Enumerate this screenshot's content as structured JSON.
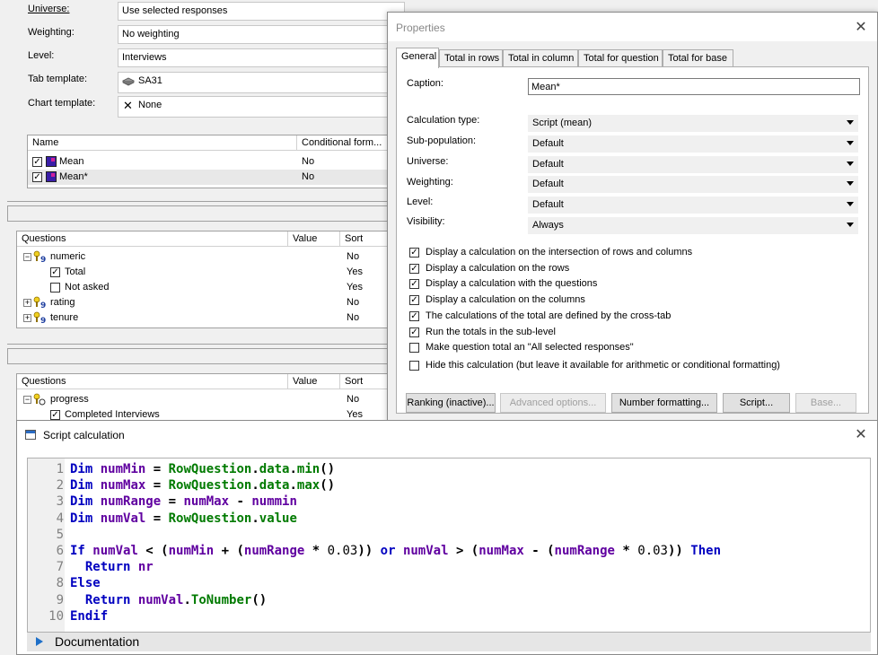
{
  "settings": {
    "universe_label": "Universe:",
    "universe_value": "Use selected responses",
    "weighting_label": "Weighting:",
    "weighting_value": "No weighting",
    "level_label": "Level:",
    "level_value": "Interviews",
    "tab_template_label": "Tab template:",
    "tab_template_value": "SA31",
    "chart_template_label": "Chart template:",
    "chart_template_value": "None"
  },
  "calc_grid": {
    "col_name": "Name",
    "col_conditional": "Conditional form...",
    "rows": [
      {
        "name": "Mean",
        "conditional": "No",
        "checked": true
      },
      {
        "name": "Mean*",
        "conditional": "No",
        "checked": true
      }
    ]
  },
  "questions_grid_1": {
    "col_questions": "Questions",
    "col_value": "Value",
    "col_sort": "Sort",
    "rows": [
      {
        "label": "numeric",
        "sort": "No"
      },
      {
        "label": "Total",
        "sort": "Yes"
      },
      {
        "label": "Not asked",
        "sort": "Yes"
      },
      {
        "label": "rating",
        "sort": "No"
      },
      {
        "label": "tenure",
        "sort": "No"
      }
    ]
  },
  "questions_grid_2": {
    "col_questions": "Questions",
    "col_value": "Value",
    "col_sort": "Sort",
    "rows": [
      {
        "label": "progress",
        "sort": "No"
      },
      {
        "label": "Completed Interviews",
        "sort": "Yes"
      }
    ]
  },
  "properties": {
    "title": "Properties",
    "tabs": [
      "General",
      "Total in rows",
      "Total in column",
      "Total for question",
      "Total for base"
    ],
    "caption_label": "Caption:",
    "caption_value": "Mean*",
    "calc_type_label": "Calculation type:",
    "calc_type_value": "Script (mean)",
    "subpop_label": "Sub-population:",
    "subpop_value": "Default",
    "universe_label": "Universe:",
    "universe_value": "Default",
    "weighting_label": "Weighting:",
    "weighting_value": "Default",
    "level_label": "Level:",
    "level_value": "Default",
    "visibility_label": "Visibility:",
    "visibility_value": "Always",
    "checks": [
      {
        "label": "Display a calculation on the intersection of rows and columns",
        "checked": true
      },
      {
        "label": "Display a calculation on the rows",
        "checked": true
      },
      {
        "label": "Display a calculation with the questions",
        "checked": true
      },
      {
        "label": "Display a calculation on the columns",
        "checked": true
      },
      {
        "label": "The calculations of the total are defined by the cross-tab",
        "checked": true
      },
      {
        "label": "Run the totals in the sub-level",
        "checked": true
      },
      {
        "label": "Make question total an \"All selected responses\"",
        "checked": false
      },
      {
        "label": "Hide this calculation (but leave it available for arithmetic or conditional formatting)",
        "checked": false
      }
    ],
    "btn_ranking": "Ranking (inactive)...",
    "btn_advanced": "Advanced options...",
    "btn_number": "Number formatting...",
    "btn_script": "Script...",
    "btn_base": "Base..."
  },
  "script": {
    "title": "Script calculation",
    "line_numbers": [
      "1",
      "2",
      "3",
      "4",
      "5",
      "6",
      "7",
      "8",
      "9",
      "10"
    ],
    "tokens": {
      "dim": "Dim",
      "if": "If",
      "or": "or",
      "then": "Then",
      "return": "Return",
      "else": "Else",
      "endif": "Endif",
      "numMin": "numMin",
      "numMax": "numMax",
      "numRange": "numRange",
      "numVal": "numVal",
      "nummin": "nummin",
      "rowq": "RowQuestion",
      "data": "data",
      "min": "min",
      "max": "max",
      "value": "value",
      "nr": "nr",
      "toNumber": "ToNumber",
      "n003": "0.03"
    },
    "documentation_label": "Documentation"
  },
  "colors": {
    "keyword": "#0000c0",
    "identifier": "#6000a0",
    "class": "#007a00",
    "accent": "#1e6fc8"
  }
}
